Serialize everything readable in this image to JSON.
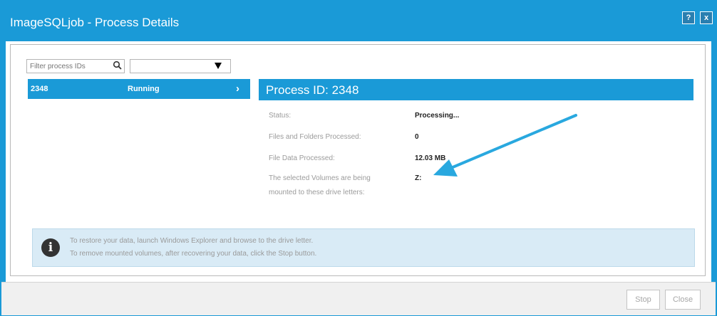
{
  "window": {
    "title": "ImageSQLjob - Process Details",
    "help_label": "?",
    "close_label": "x"
  },
  "filter": {
    "placeholder": "Filter process IDs",
    "status_selected": ""
  },
  "process_list": [
    {
      "id": "2348",
      "status": "Running",
      "chevron": "›"
    }
  ],
  "details": {
    "header": "Process ID: 2348",
    "rows": [
      {
        "label": "Status:",
        "value": "Processing..."
      },
      {
        "label": "Files and Folders Processed:",
        "value": "0"
      },
      {
        "label": "File Data Processed:",
        "value": "12.03 MB"
      },
      {
        "label": "The selected Volumes are being mounted to these drive letters:",
        "value": "Z:"
      }
    ]
  },
  "info": {
    "icon": "info-icon",
    "line1": "To restore your data, launch Windows Explorer and browse to the drive letter.",
    "line2": "To remove mounted volumes, after recovering your data, click the Stop button."
  },
  "footer": {
    "stop_label": "Stop",
    "close_label": "Close"
  },
  "colors": {
    "accent": "#1a9ad7",
    "info_bg": "#d9ebf6",
    "annotation_arrow": "#29a8df"
  }
}
